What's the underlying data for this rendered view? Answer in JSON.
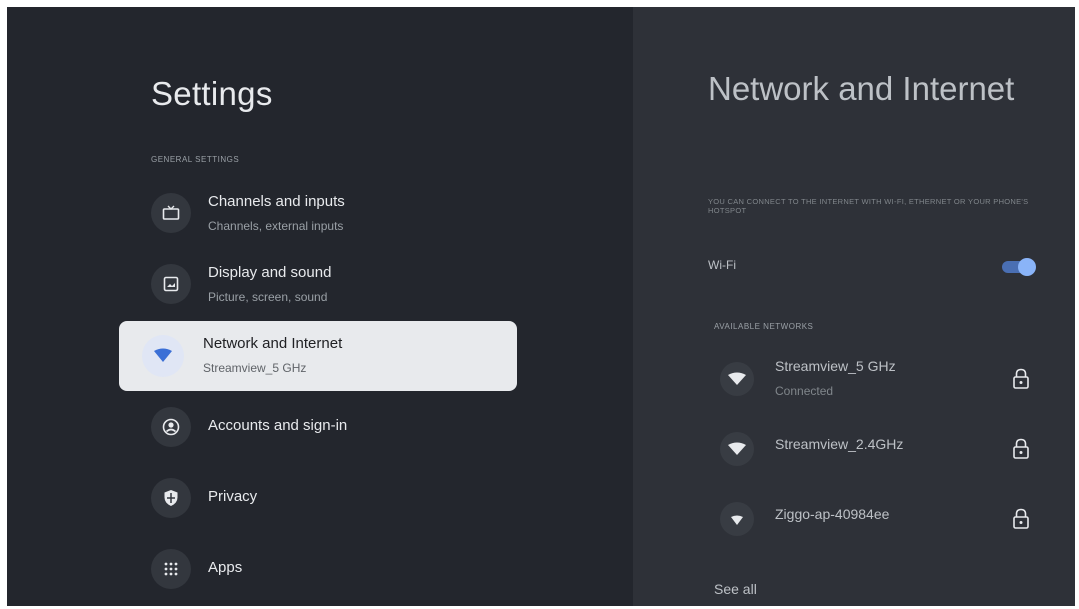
{
  "settings": {
    "title": "Settings",
    "section_label": "GENERAL SETTINGS",
    "items": [
      {
        "label": "Channels and inputs",
        "sub": "Channels, external inputs",
        "icon": "tv-icon"
      },
      {
        "label": "Display and sound",
        "sub": "Picture, screen, sound",
        "icon": "display-icon"
      },
      {
        "label": "Network and Internet",
        "sub": "Streamview_5 GHz",
        "icon": "wifi-icon",
        "selected": true
      },
      {
        "label": "Accounts and sign-in",
        "sub": "",
        "icon": "account-icon"
      },
      {
        "label": "Privacy",
        "sub": "",
        "icon": "shield-icon"
      },
      {
        "label": "Apps",
        "sub": "",
        "icon": "apps-grid-icon"
      }
    ]
  },
  "network": {
    "title": "Network and Internet",
    "description": "YOU CAN CONNECT TO THE INTERNET WITH WI-FI, ETHERNET OR YOUR PHONE'S HOTSPOT",
    "wifi_label": "Wi-Fi",
    "wifi_enabled": true,
    "available_label": "AVAILABLE NETWORKS",
    "networks": [
      {
        "name": "Streamview_5 GHz",
        "status": "Connected",
        "secured": true
      },
      {
        "name": "Streamview_2.4GHz",
        "status": "",
        "secured": true
      },
      {
        "name": "Ziggo-ap-40984ee",
        "status": "",
        "secured": true
      }
    ],
    "see_all": "See all"
  },
  "colors": {
    "background": "#23262d",
    "panel": "#2e3138",
    "selected_bg": "#e8eaed",
    "accent": "#8ab4f8",
    "wifi_selected": "#3b6fd6"
  }
}
